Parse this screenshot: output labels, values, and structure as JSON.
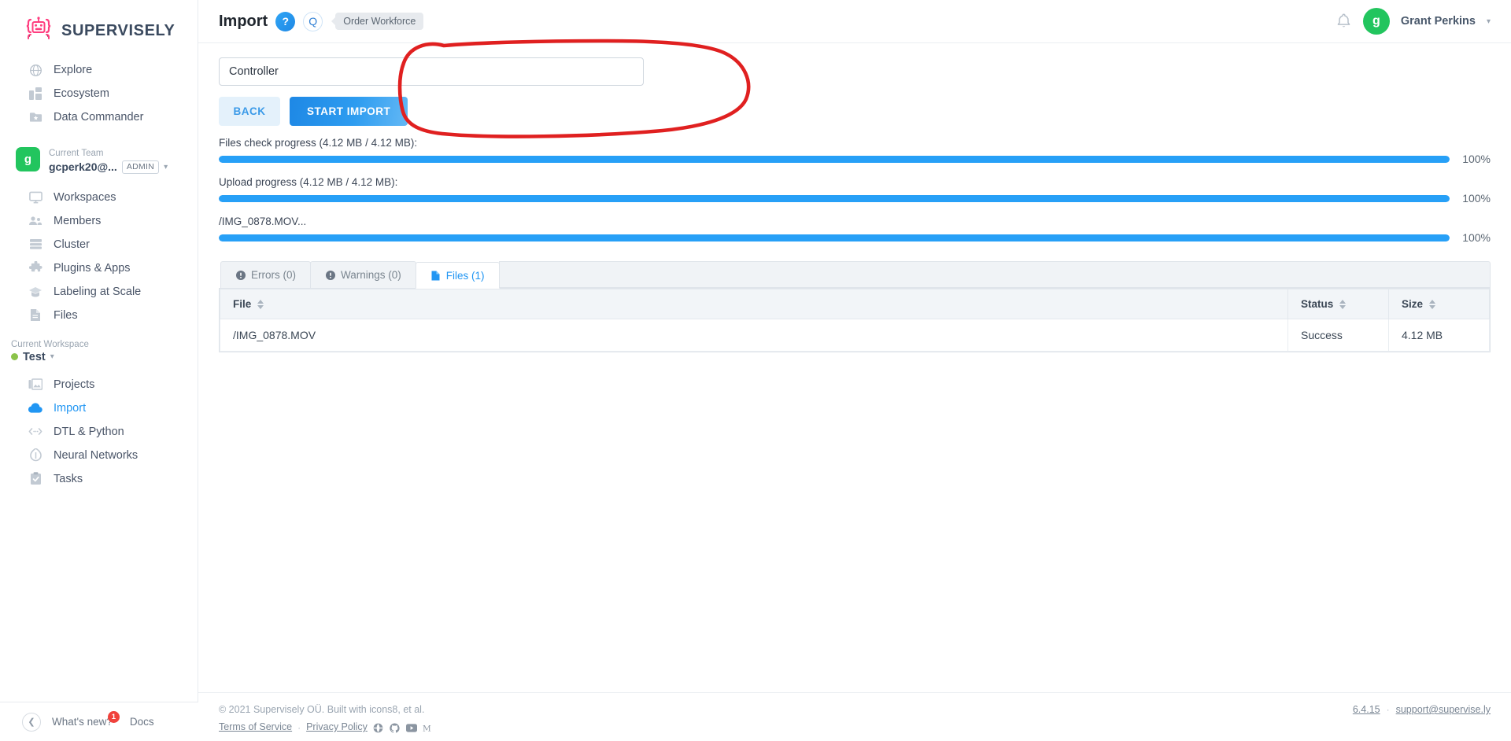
{
  "brand": {
    "name": "SUPERVISELY",
    "logo_icon": "robot-logo-icon",
    "accent": "#ff4081"
  },
  "sidebar": {
    "global_items": [
      {
        "label": "Explore",
        "icon": "globe-icon"
      },
      {
        "label": "Ecosystem",
        "icon": "grid-blocks-icon"
      },
      {
        "label": "Data Commander",
        "icon": "folder-star-icon"
      }
    ],
    "team": {
      "section_label": "Current Team",
      "avatar_letter": "g",
      "name": "gcperk20@...",
      "role_badge": "ADMIN",
      "avatar_color": "#22c55e"
    },
    "team_items": [
      {
        "label": "Workspaces",
        "icon": "monitor-icon"
      },
      {
        "label": "Members",
        "icon": "people-icon"
      },
      {
        "label": "Cluster",
        "icon": "server-list-icon"
      },
      {
        "label": "Plugins & Apps",
        "icon": "puzzle-icon"
      },
      {
        "label": "Labeling at Scale",
        "icon": "graduation-cap-icon"
      },
      {
        "label": "Files",
        "icon": "file-icon"
      }
    ],
    "workspace": {
      "section_label": "Current Workspace",
      "name": "Test",
      "dot_color": "#8bc34a"
    },
    "workspace_items": [
      {
        "label": "Projects",
        "icon": "images-icon",
        "active": false
      },
      {
        "label": "Import",
        "icon": "cloud-upload-icon",
        "active": true
      },
      {
        "label": "DTL & Python",
        "icon": "code-brackets-icon",
        "active": false
      },
      {
        "label": "Neural Networks",
        "icon": "neural-net-icon",
        "active": false
      },
      {
        "label": "Tasks",
        "icon": "clipboard-check-icon",
        "active": false
      }
    ],
    "footer": {
      "collapse_icon": "chevron-left-icon",
      "whats_new_label": "What's new?",
      "whats_new_count": "1",
      "docs_label": "Docs"
    }
  },
  "topbar": {
    "title": "Import",
    "help_label": "?",
    "q_label": "Q",
    "tooltip": "Order Workforce",
    "bell_icon": "bell-icon",
    "user": {
      "avatar_letter": "g",
      "name": "Grant Perkins",
      "avatar_color": "#22c55e"
    }
  },
  "form": {
    "project_name_value": "Controller",
    "project_name_placeholder": "Project name",
    "back_label": "BACK",
    "start_import_label": "START IMPORT"
  },
  "progress": [
    {
      "label": "Files check progress (4.12 MB / 4.12 MB):",
      "percent": "100%",
      "value": 100
    },
    {
      "label": "Upload progress (4.12 MB / 4.12 MB):",
      "percent": "100%",
      "value": 100
    },
    {
      "label": "/IMG_0878.MOV...",
      "percent": "100%",
      "value": 100
    }
  ],
  "tabs": [
    {
      "label": "Errors (0)",
      "icon": "exclamation-circle-icon",
      "active": false
    },
    {
      "label": "Warnings (0)",
      "icon": "exclamation-circle-icon",
      "active": false
    },
    {
      "label": "Files (1)",
      "icon": "file-icon",
      "active": true
    }
  ],
  "table": {
    "columns": [
      "File",
      "Status",
      "Size"
    ],
    "rows": [
      {
        "file": "/IMG_0878.MOV",
        "status": "Success",
        "size": "4.12 MB"
      }
    ]
  },
  "footer": {
    "copyright": "© 2021 Supervisely OÜ. Built with icons8, et al.",
    "terms_label": "Terms of Service",
    "separator": "·",
    "privacy_label": "Privacy Policy",
    "social": [
      "website-icon",
      "github-icon",
      "youtube-icon",
      "medium-icon"
    ],
    "version": "6.4.15",
    "support_email": "support@supervise.ly"
  },
  "annotation": {
    "shape": "red-hand-drawn-oval",
    "color": "#e02020"
  }
}
